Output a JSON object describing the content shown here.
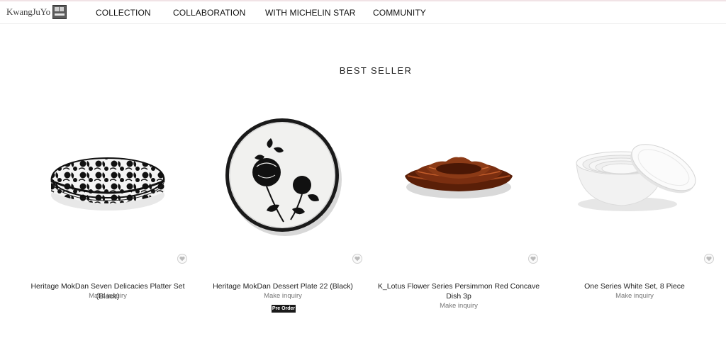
{
  "header": {
    "logo_text": "KwangJuYo",
    "nav": [
      {
        "label": "COLLECTION"
      },
      {
        "label": "COLLABORATION"
      },
      {
        "label": "WITH MICHELIN STAR"
      },
      {
        "label": "COMMUNITY"
      }
    ]
  },
  "section": {
    "title": "BEST SELLER"
  },
  "products": [
    {
      "name": "Heritage MokDan Seven Delicacies Platter Set (Black)",
      "action": "Make inquiry",
      "image": "black-peony-round-box"
    },
    {
      "name": "Heritage MokDan Dessert Plate 22 (Black)",
      "action": "Make inquiry",
      "badge": "Pre Order",
      "image": "black-peony-plate"
    },
    {
      "name": "K_Lotus Flower Series Persimmon Red Concave Dish 3p",
      "action": "Make inquiry",
      "image": "lotus-stacked-dishes"
    },
    {
      "name": "One Series White Set, 8 Piece",
      "action": "Make inquiry",
      "image": "white-nesting-bowls"
    }
  ],
  "icons": {
    "wishlist": "heart-icon"
  },
  "colors": {
    "accent_line": "#f1e3e6",
    "badge_bg": "#1a1a1a",
    "persimmon": "#7a2e10"
  }
}
